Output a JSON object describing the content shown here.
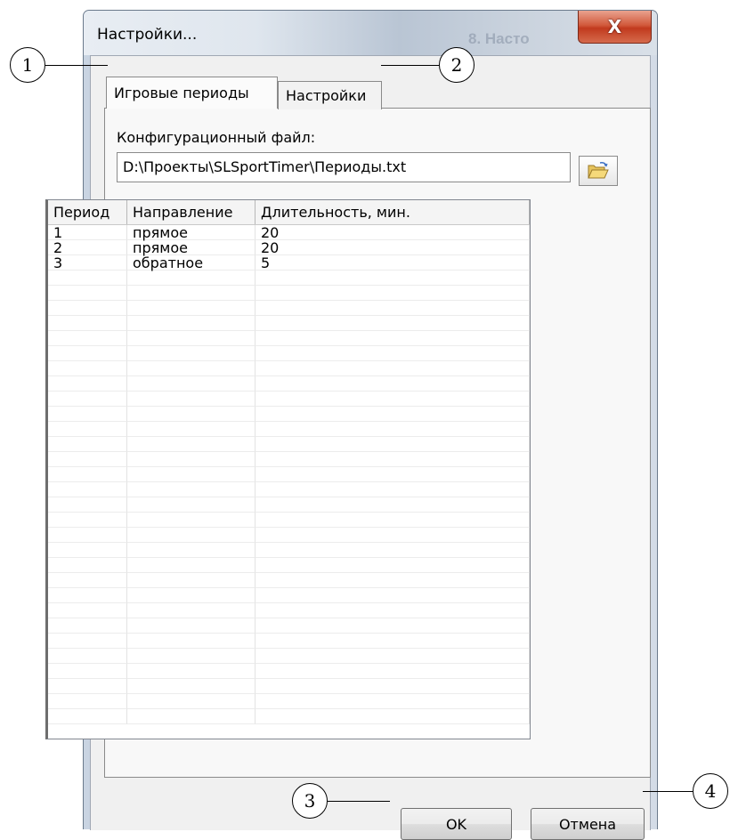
{
  "window": {
    "title": "Настройки...",
    "background_title": "8. Насто",
    "close_glyph": "X"
  },
  "tabs": [
    {
      "label": "Игровые периоды",
      "active": true
    },
    {
      "label": "Настройки",
      "active": false
    }
  ],
  "config": {
    "label": "Конфигурационный файл:",
    "path": "D:\\Проекты\\SLSportTimer\\Периоды.txt"
  },
  "table": {
    "headers": [
      "Период",
      "Направление",
      "Длительность, мин."
    ],
    "rows": [
      [
        "1",
        "прямое",
        "20"
      ],
      [
        "2",
        "прямое",
        "20"
      ],
      [
        "3",
        "обратное",
        "5"
      ]
    ],
    "empty_rows": 30
  },
  "buttons": {
    "ok": "OK",
    "cancel": "Отмена"
  },
  "callouts": [
    "1",
    "2",
    "3",
    "4"
  ],
  "icons": {
    "browse": "folder-open-icon",
    "close": "close-icon"
  }
}
